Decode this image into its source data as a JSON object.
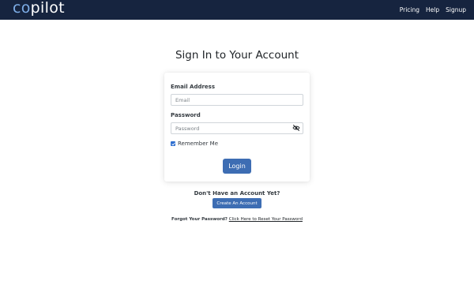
{
  "navbar": {
    "brand_co": "co",
    "brand_pilot": "pilot",
    "links": [
      "Pricing",
      "Help",
      "Signup"
    ],
    "background_color": "#16243f",
    "brand_accent_color": "#7eaee8"
  },
  "page": {
    "title": "Sign In to Your Account"
  },
  "form": {
    "email_label": "Email Address",
    "email_placeholder": "Email",
    "email_value": "",
    "password_label": "Password",
    "password_placeholder": "Password",
    "password_value": "",
    "password_toggle_icon": "eye-slash-icon",
    "remember_label": "Remember Me",
    "remember_checked": true,
    "login_label": "Login",
    "button_color": "#3d6db3"
  },
  "signup": {
    "prompt": "Don't Have an Account Yet?",
    "button_label": "Create An Account"
  },
  "forgot": {
    "prompt": "Forgot Your Password?",
    "link_text": "Click Here to Reset Your Password"
  }
}
